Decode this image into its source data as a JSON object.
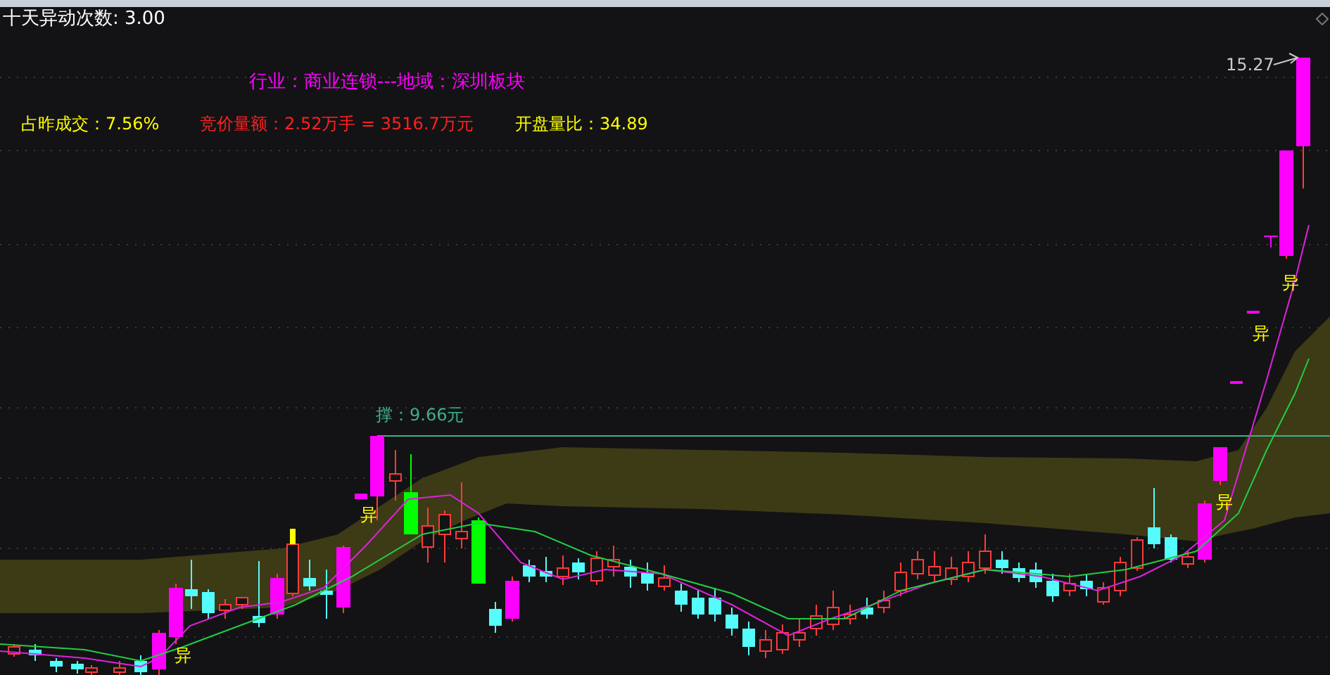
{
  "title": "十天异动次数: 3.00",
  "industry_line": "行业：商业连锁---地域：深圳板块",
  "stats": [
    {
      "kind": "yellow",
      "text": "占昨成交：7.56%"
    },
    {
      "kind": "red",
      "text": "竞价量额：2.52万手 = 3516.7万元"
    },
    {
      "kind": "yellow",
      "text": "开盘量比：34.89"
    }
  ],
  "support_label": "撑：9.66元",
  "high_label": "15.27",
  "markers": [
    {
      "text": "异"
    },
    {
      "text": "异"
    },
    {
      "text": "异"
    },
    {
      "text": "异"
    },
    {
      "text": "异"
    }
  ]
}
